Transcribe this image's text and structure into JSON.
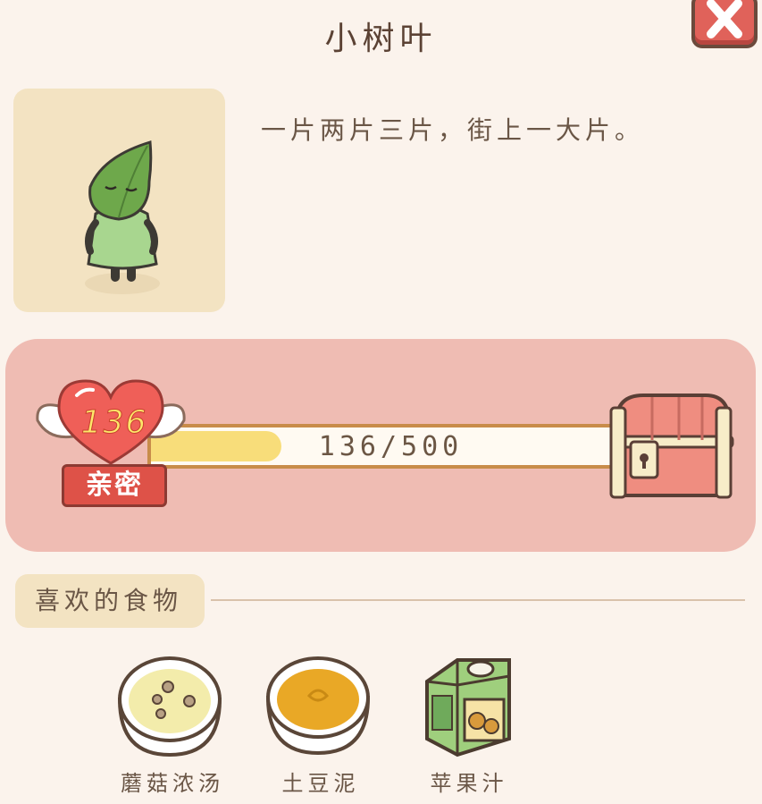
{
  "character": {
    "name": "小树叶",
    "description": "一片两片三片，街上一大片。"
  },
  "bond": {
    "level_value": "136",
    "label": "亲密",
    "progress_text": "136/500",
    "current": 136,
    "max": 500,
    "progress_fraction": 0.272
  },
  "favorites": {
    "heading": "喜欢的食物",
    "items": [
      {
        "name": "蘑菇浓汤",
        "icon": "mushroom-soup-icon"
      },
      {
        "name": "土豆泥",
        "icon": "mashed-potato-icon"
      },
      {
        "name": "苹果汁",
        "icon": "apple-juice-icon"
      }
    ]
  },
  "icons": {
    "close": "close-icon",
    "heart": "winged-heart-icon",
    "chest": "treasure-chest-icon"
  },
  "colors": {
    "background": "#fbf3ec",
    "panel_pink": "#efbcb3",
    "card_beige": "#f3e3c2",
    "progress_fill": "#f8dd7a",
    "close_red": "#e0625a"
  }
}
